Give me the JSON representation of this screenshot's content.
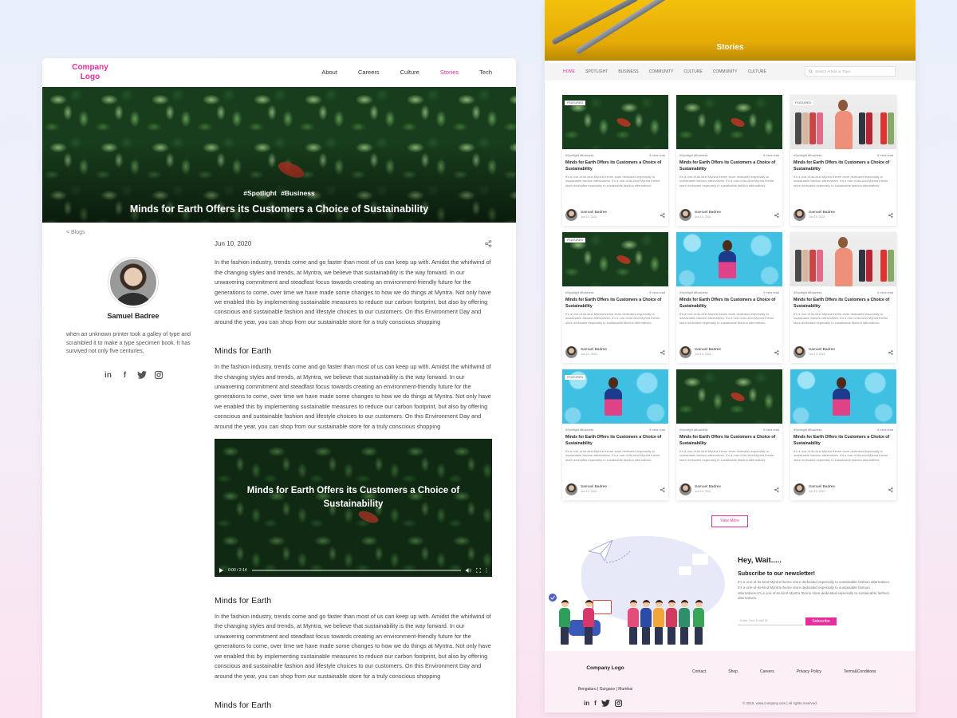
{
  "article": {
    "logo": "Company Logo",
    "nav": [
      "About",
      "Careers",
      "Culture",
      "Stories",
      "Tech"
    ],
    "active_nav": "Stories",
    "hero": {
      "tags": "#Spotlight  #Business",
      "title": "Minds for Earth Offers its Customers a Choice of Sustainability"
    },
    "breadcrumb": "< Blogs",
    "author": {
      "name": "Samuel Badree",
      "bio": "when an unknown printer took a galley of type and scrambled it to make a type specimen book. It has survived not only five centuries,"
    },
    "social": [
      "in",
      "f",
      "twitter",
      "instagram"
    ],
    "date": "Jun 10, 2020",
    "paragraph": "In the fashion industry, trends come and go faster than most of us can keep up with. Amidst the whirlwind of the changing styles and trends, at Myntra, we believe that sustainability is the way forward. In our unwavering commitment and steadfast focus towards creating an environment-friendly future for the generations to come, over time we have made some changes to how we do things at Myntra. Not only have we enabled this by implementing sustainable measures to reduce our carbon footprint, but also by offering conscious and sustainable fashion and lifestyle choices to our customers. On this Environment Day and around the year, you can shop from our sustainable store for a truly conscious shopping",
    "section_heading": "Minds for Earth",
    "video": {
      "title": "Minds for Earth Offers its Customers a Choice of Sustainability",
      "time": "0:00 / 2:14"
    }
  },
  "stories": {
    "hero_title": "Stories",
    "tabs": [
      "HOME",
      "SPOTLIGHT",
      "BUSINESS",
      "COMMUNITY",
      "CULTURE",
      "COMMUNITY",
      "CULTURE"
    ],
    "search_placeholder": "Search Article or Topic",
    "card": {
      "featured": "FEATURED",
      "tags": "#Spotlight  #Business",
      "read_time": "5 mins read",
      "title": "Minds for Earth Offers its Customers a Choice of Sustainability",
      "desc": "It's a one-of-its-kind Myntra theme store dedicated especially to sustainable fashion alternatives. It's a one-of-its-kind Myntra theme store dedicated especially to sustainable fashion alternatives.",
      "author": "Samuel Badree",
      "date": "Jun 10, 2021"
    },
    "cards": [
      {
        "image": "leaves",
        "featured": true
      },
      {
        "image": "leaves",
        "featured": false
      },
      {
        "image": "clothes-rack",
        "featured": true
      },
      {
        "image": "leaves",
        "featured": true
      },
      {
        "image": "balloons",
        "featured": false
      },
      {
        "image": "clothes-rack",
        "featured": false
      },
      {
        "image": "balloons",
        "featured": true
      },
      {
        "image": "leaves",
        "featured": false
      },
      {
        "image": "balloons",
        "featured": false
      }
    ],
    "view_more": "View More",
    "newsletter": {
      "heading": "Hey, Wait.....",
      "subheading": "Subscribe to our newsletter!",
      "text": "It's a one-of-its-kind Myntra theme store dedicated especially to sustainable fashion alternatives. It's a one-of-its-kind Myntra theme store dedicated especially to sustainable fashion alternatives.It's a one-of-its-kind Myntra theme store dedicated especially to sustainable fashion alternatives.",
      "email_placeholder": "Enter Your Email ID",
      "button": "Subscribe"
    },
    "footer": {
      "logo": "Company Logo",
      "cities": "Bengaluru  |  Gurgaon  |  Mumbai",
      "links": [
        "Contact",
        "Shop",
        "Careers",
        "Privacy Policy",
        "Terms&Conditions"
      ],
      "copyright": "© 2019, www.company.com  |  All rights reserved."
    }
  },
  "colors": {
    "accent": "#e52e9c",
    "hero_yellow": "#f4c10c",
    "leaf_green": "#183d1c",
    "balloon_blue": "#3fc0e3"
  }
}
